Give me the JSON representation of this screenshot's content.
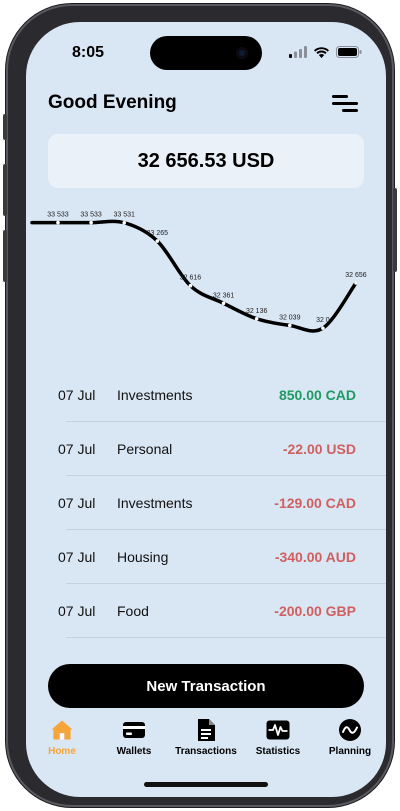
{
  "status": {
    "time": "8:05"
  },
  "header": {
    "greeting": "Good Evening"
  },
  "balance": {
    "total": "32 656.53 USD"
  },
  "chart_data": {
    "type": "line",
    "x": [
      0,
      1,
      2,
      3,
      4,
      5,
      6,
      7,
      8,
      9
    ],
    "values": [
      33533,
      33533,
      33531,
      33265,
      32616,
      32361,
      32136,
      32039,
      32000,
      32656
    ],
    "data_labels": [
      "33 533",
      "33 533",
      "33 531",
      "33 265",
      "32 616",
      "32 361",
      "32 136",
      "32 039",
      "32 0",
      "32 656"
    ],
    "ylim": [
      31900,
      33600
    ],
    "title": "",
    "xlabel": "",
    "ylabel": "",
    "grid": false,
    "color": "#000000"
  },
  "transactions": [
    {
      "date": "07 Jul",
      "category": "Investments",
      "amount": "850.00 CAD",
      "kind": "pos"
    },
    {
      "date": "07 Jul",
      "category": "Personal",
      "amount": "-22.00 USD",
      "kind": "neg"
    },
    {
      "date": "07 Jul",
      "category": "Investments",
      "amount": "-129.00 CAD",
      "kind": "neg"
    },
    {
      "date": "07 Jul",
      "category": "Housing",
      "amount": "-340.00 AUD",
      "kind": "neg"
    },
    {
      "date": "07 Jul",
      "category": "Food",
      "amount": "-200.00 GBP",
      "kind": "neg"
    }
  ],
  "actions": {
    "new_transaction": "New Transaction"
  },
  "tabs": [
    {
      "label": "Home",
      "icon": "home-icon"
    },
    {
      "label": "Wallets",
      "icon": "wallet-icon"
    },
    {
      "label": "Transactions",
      "icon": "document-icon"
    },
    {
      "label": "Statistics",
      "icon": "pulse-icon"
    },
    {
      "label": "Planning",
      "icon": "trend-circle-icon"
    }
  ],
  "colors": {
    "background": "#d9e6f4",
    "positive": "#1f9a63",
    "negative": "#d05f5f",
    "accent": "#f6a53a"
  }
}
